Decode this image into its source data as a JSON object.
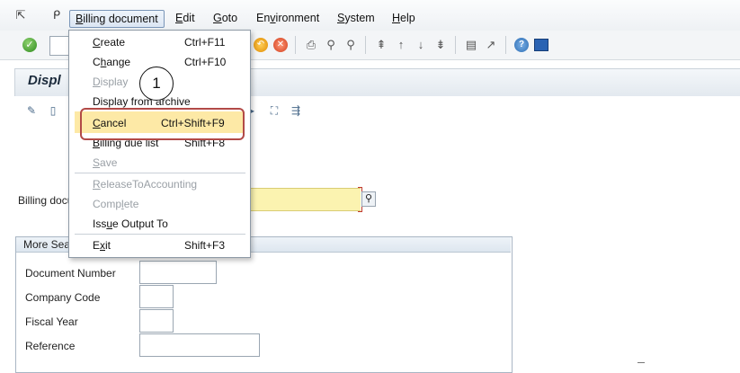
{
  "menubar": {
    "items": [
      {
        "label_pre": "",
        "label_u": "B",
        "label_post": "illing document"
      },
      {
        "label_pre": "",
        "label_u": "E",
        "label_post": "dit"
      },
      {
        "label_pre": "",
        "label_u": "G",
        "label_post": "oto"
      },
      {
        "label_pre": "En",
        "label_u": "v",
        "label_post": "ironment"
      },
      {
        "label_pre": "",
        "label_u": "S",
        "label_post": "ystem"
      },
      {
        "label_pre": "",
        "label_u": "H",
        "label_post": "elp"
      }
    ]
  },
  "title": {
    "text": "Displ"
  },
  "form": {
    "billing_document_label": "Billing docu",
    "billing_document_value": ""
  },
  "group": {
    "title": "More Sea",
    "fields": [
      {
        "label": "Document Number",
        "value": ""
      },
      {
        "label": "Company Code",
        "value": ""
      },
      {
        "label": "Fiscal Year",
        "value": ""
      },
      {
        "label": "Reference",
        "value": ""
      }
    ]
  },
  "dropdown": {
    "items": [
      {
        "pre": "",
        "u": "C",
        "post": "reate",
        "accel": "Ctrl+F11",
        "enabled": true
      },
      {
        "pre": "C",
        "u": "h",
        "post": "ange",
        "accel": "Ctrl+F10",
        "enabled": true
      },
      {
        "pre": "",
        "u": "D",
        "post": "isplay",
        "accel": "",
        "enabled": false
      },
      {
        "pre": "Display from archive",
        "u": "",
        "post": "",
        "accel": "",
        "enabled": true
      },
      {
        "pre": "",
        "u": "C",
        "post": "ancel",
        "accel": "Ctrl+Shift+F9",
        "enabled": true,
        "highlighted": true
      },
      {
        "pre": "",
        "u": "B",
        "post": "illing due list",
        "accel": "Shift+F8",
        "enabled": true
      },
      {
        "pre": "",
        "u": "S",
        "post": "ave",
        "accel": "",
        "enabled": false
      },
      {
        "pre": "",
        "u": "R",
        "post": "eleaseToAccounting",
        "accel": "",
        "enabled": false
      },
      {
        "pre": "Comp",
        "u": "l",
        "post": "ete",
        "accel": "",
        "enabled": false
      },
      {
        "pre": "Iss",
        "u": "u",
        "post": "e Output To",
        "accel": "",
        "enabled": true
      },
      {
        "pre": "E",
        "u": "x",
        "post": "it",
        "accel": "Shift+F3",
        "enabled": true
      }
    ]
  },
  "callout": {
    "number": "1"
  },
  "icons": {
    "menu_left": "exit-menu-icon",
    "menu_sap": "sap-menu-icon",
    "toolbar": [
      "enter-icon",
      "back-icon",
      "cancel-icon",
      "print-icon",
      "find-icon",
      "find-next-icon",
      "first-page-icon",
      "prev-page-icon",
      "next-page-icon",
      "last-page-icon",
      "new-session-icon",
      "shortcut-icon",
      "help-icon",
      "customize-icon"
    ]
  }
}
